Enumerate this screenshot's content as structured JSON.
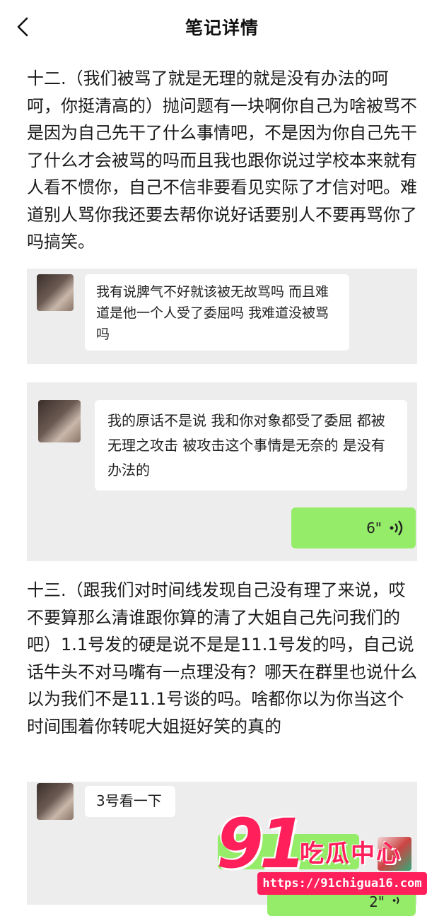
{
  "header": {
    "title": "笔记详情"
  },
  "sections": [
    {
      "text": "十二.（我们被骂了就是无理的就是没有办法的呵呵，你挺清高的）抛问题有一块啊你自己为啥被骂不是因为自己先干了什么事情吧，不是因为你自己先干了什么才会被骂的吗而且我也跟你说过学校本来就有人看不惯你，自己不信非要看见实际了才信对吧。难道别人骂你我还要去帮你说好话要别人不要再骂你了吗搞笑。"
    },
    {
      "text": "十三.（跟我们对时间线发现自己没有理了来说，哎不要算那么清谁跟你算的清了大姐自己先问我们的吧）1.1号发的硬是说不是是11.1号发的吗，自己说话牛头不对马嘴有一点理没有？哪天在群里也说什么以为我们不是11.1号谈的吗。啥都你以为你当这个时间围着你转呢大姐挺好笑的真的"
    }
  ],
  "chat1": {
    "message": "我有说脾气不好就该被无故骂吗 而且难道是他一个人受了委屈吗 我难道没被骂吗"
  },
  "chat2": {
    "message": "我的原话不是说 我和你对象都受了委屈 都被无理之攻击 被攻击这个事情是无奈的 是没有办法的",
    "voice_duration": "6\""
  },
  "chat3": {
    "message": "3号看一下",
    "voice_duration": "2\""
  },
  "watermark": {
    "number": "91",
    "name": "吃瓜中心",
    "url": "https://91chigua16.com"
  }
}
